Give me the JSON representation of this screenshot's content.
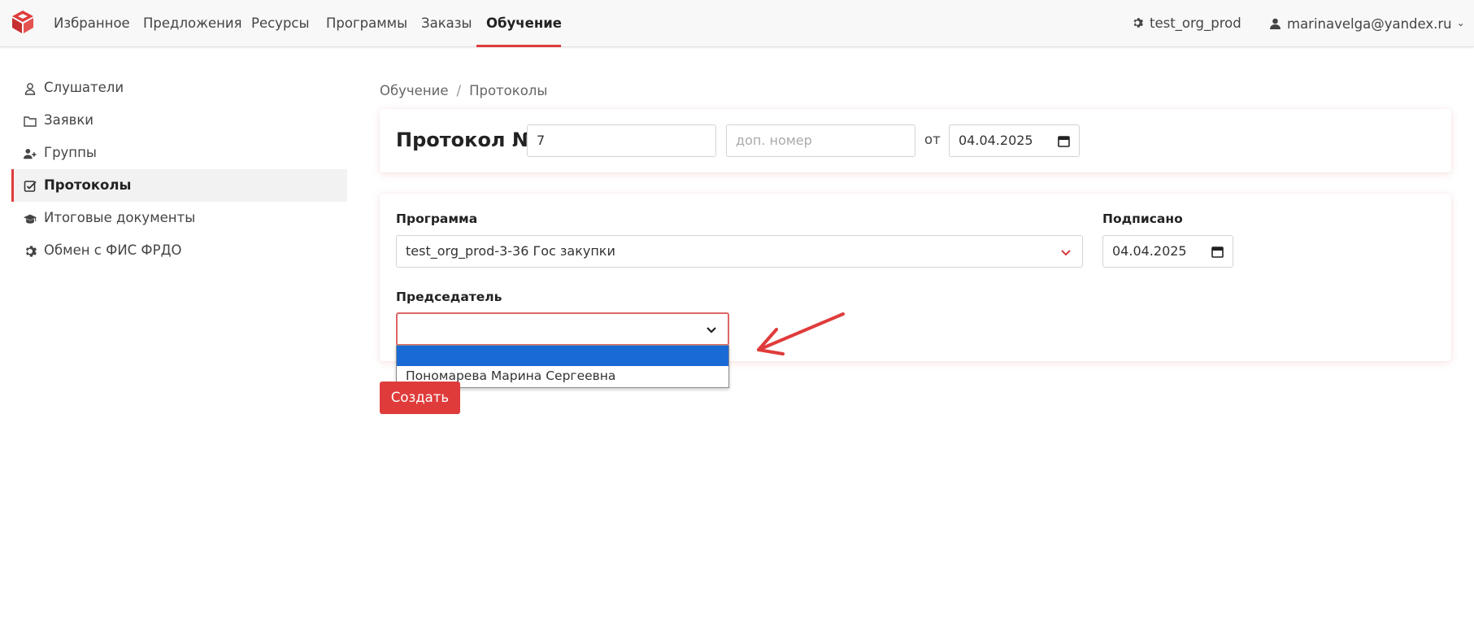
{
  "navbar": {
    "items": [
      {
        "label": "Избранное"
      },
      {
        "label": "Предложения"
      },
      {
        "label": "Ресурсы"
      },
      {
        "label": "Программы"
      },
      {
        "label": "Заказы"
      },
      {
        "label": "Обучение",
        "active": true
      }
    ],
    "org": "test_org_prod",
    "user": "marinavelga@yandex.ru"
  },
  "sidebar": {
    "items": [
      {
        "label": "Слушатели",
        "icon": "user-icon"
      },
      {
        "label": "Заявки",
        "icon": "folder-icon"
      },
      {
        "label": "Группы",
        "icon": "user-plus-icon"
      },
      {
        "label": "Протоколы",
        "icon": "check-square-icon",
        "active": true
      },
      {
        "label": "Итоговые документы",
        "icon": "graduation-cap-icon"
      },
      {
        "label": "Обмен с ФИС ФРДО",
        "icon": "gear-icon"
      }
    ]
  },
  "breadcrumb": {
    "root": "Обучение",
    "sep": "/",
    "current": "Протоколы"
  },
  "protocol": {
    "title": "Протокол №",
    "number": "7",
    "extra_placeholder": "доп. номер",
    "from_label": "от",
    "date": "04.04.2025"
  },
  "form": {
    "program_label": "Программа",
    "program_value": "test_org_prod-3-36 Гос закупки",
    "signed_label": "Подписано",
    "signed_date": "04.04.2025",
    "chair_label": "Председатель",
    "chair_value": "",
    "chair_options": [
      "",
      "Пономарева Марина Сергеевна"
    ]
  },
  "actions": {
    "create": "Создать"
  },
  "colors": {
    "accent": "#e03b3b",
    "highlight": "#1a6ad6",
    "annotation_arrow": "#e03b3b"
  }
}
